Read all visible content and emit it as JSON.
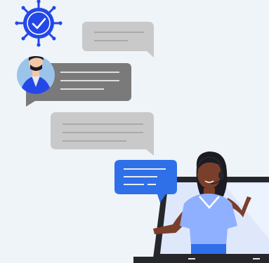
{
  "illustration": {
    "subject": "customer-support-chat",
    "icons": [
      "verified-badge-icon",
      "checkmark-icon"
    ],
    "colors": {
      "background": "#eef4f8",
      "accent_blue": "#2448e8",
      "bubble_gray_light": "#c9c9c9",
      "bubble_gray_dark": "#7a7a7a",
      "bubble_blue": "#2f6fe8",
      "shirt_blue": "#8fb0ff",
      "laptop_dark": "#26272b",
      "skin_dark": "#7a3f2a",
      "skin_light": "#f2c8a8",
      "hair_dark": "#1c1b24"
    }
  }
}
